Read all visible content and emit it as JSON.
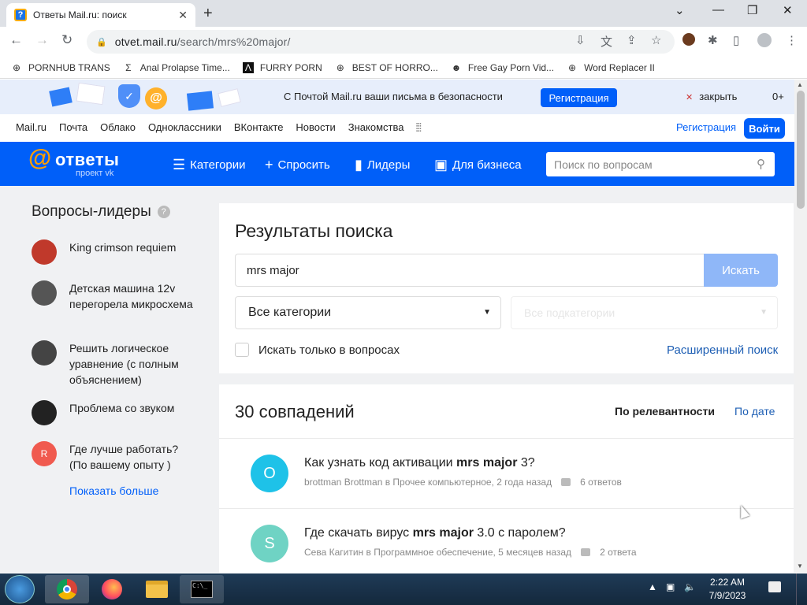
{
  "browser": {
    "tab_title": "Ответы Mail.ru: поиск",
    "url_host": "otvet.mail.ru",
    "url_path": "/search/mrs%20major/",
    "bookmarks": [
      {
        "label": "PORNHUB TRANS",
        "icon": "globe-icon"
      },
      {
        "label": "Anal Prolapse Time...",
        "icon": "sigma-icon"
      },
      {
        "label": "FURRY PORN",
        "icon": "a-logo-icon"
      },
      {
        "label": "BEST OF HORRO...",
        "icon": "globe-icon"
      },
      {
        "label": "Free Gay Porn Vid...",
        "icon": "cat-icon"
      },
      {
        "label": "Word Replacer II",
        "icon": "globe-icon"
      }
    ]
  },
  "banner": {
    "message": "С Почтой Mail.ru ваши письма в безопасности",
    "register": "Регистрация",
    "close": "закрыть",
    "age": "0+"
  },
  "topnav": {
    "links": [
      "Mail.ru",
      "Почта",
      "Облако",
      "Одноклассники",
      "ВКонтакте",
      "Новости",
      "Знакомства"
    ],
    "register": "Регистрация",
    "login": "Войти"
  },
  "header": {
    "logo_word": "ответы",
    "logo_sub": "проект vk",
    "nav": [
      "Категории",
      "Спросить",
      "Лидеры",
      "Для бизнеса"
    ],
    "search_placeholder": "Поиск по вопросам"
  },
  "sidebar": {
    "title": "Вопросы-лидеры",
    "leaders": [
      {
        "text": "King crimson requiem",
        "avatar_color": "#c0392b"
      },
      {
        "text": "Детская машина 12v перегорела микросхема",
        "avatar_color": "#555555"
      },
      {
        "text": "Решить логическое уравнение (с полным объяснением)",
        "avatar_color": "#444444"
      },
      {
        "text": "Проблема со звуком",
        "avatar_color": "#222222"
      },
      {
        "text": "Где лучше работать? (По вашему опыту )",
        "avatar_color": "#f05a4f",
        "initial": "R"
      }
    ],
    "show_more": "Показать больше"
  },
  "search": {
    "title": "Результаты поиска",
    "query": "mrs major",
    "button": "Искать",
    "category": "Все категории",
    "subcategory": "Все подкатегории",
    "only_questions": "Искать только в вопросах",
    "advanced": "Расширенный поиск"
  },
  "results": {
    "count": "30 совпадений",
    "sort_relevance": "По релевантности",
    "sort_date": "По дате",
    "items": [
      {
        "initial": "O",
        "avatar_color": "#1ec2e8",
        "q_pre": "Как узнать код активации ",
        "q_bold": "mrs major",
        "q_post": " 3?",
        "meta": "brottman Brottman в Прочее компьютерное, 2 года назад",
        "answers": "6 ответов"
      },
      {
        "initial": "S",
        "avatar_color": "#6fd3c4",
        "q_pre": "Где скачать вирус ",
        "q_bold": "mrs major",
        "q_post": " 3.0 с паролем?",
        "meta": "Сева Кагитин в Программное обеспечение, 5 месяцев назад",
        "answers": "2 ответа"
      }
    ]
  },
  "taskbar": {
    "time": "2:22 AM",
    "date": "7/9/2023"
  }
}
